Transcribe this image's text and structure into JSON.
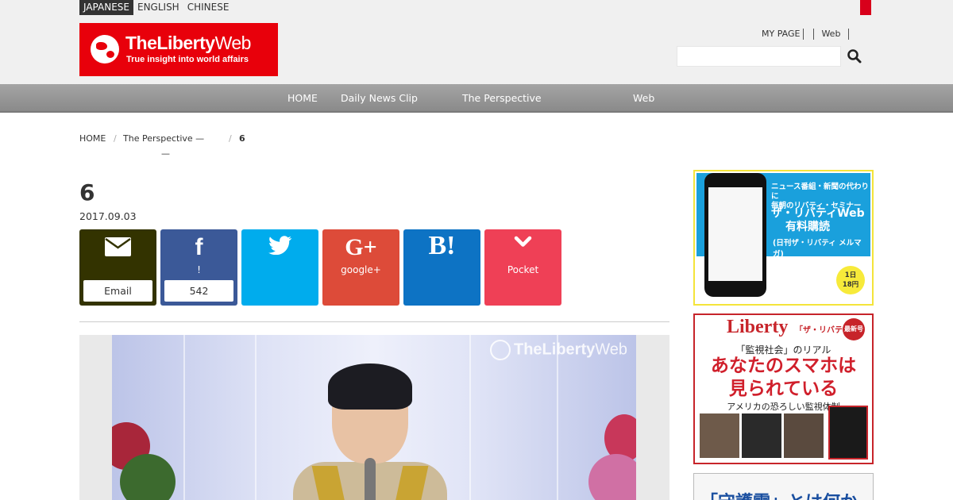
{
  "header": {
    "languages": [
      "JAPANESE",
      "ENGLISH",
      "CHINESE"
    ],
    "active_language": "JAPANESE",
    "logo_name": "TheLiberty",
    "logo_name_suffix": "Web",
    "logo_tagline": "True insight into world affairs",
    "links": [
      "MY PAGE",
      "Web"
    ],
    "search_placeholder": ""
  },
  "nav": {
    "items": [
      "HOME",
      "Daily News Clip",
      "The Perspective",
      "Web"
    ]
  },
  "breadcrumb": {
    "home": "HOME",
    "section": "The Perspective —",
    "section_line2": "—",
    "current": "6"
  },
  "article": {
    "title": "6",
    "date": "2017.09.03"
  },
  "share": {
    "email_label": "Email",
    "facebook_label": "!",
    "facebook_count": "542",
    "googleplus_label": "google+",
    "hatena_icon_text": "B!",
    "pocket_label": "Pocket"
  },
  "photo": {
    "watermark_name": "TheLiberty",
    "watermark_suffix": "Web"
  },
  "sidebar": {
    "ad1": {
      "line1": "ニュース番組・新聞の代わりに",
      "line1b": "毎朝のリバティ・セミナー",
      "line2": "ザ・リバティWeb",
      "line2b": "有料購読",
      "line3": "(日刊ザ・リバティ メルマガ)",
      "badge1": "1日",
      "badge2": "18円"
    },
    "ad2": {
      "brand": "Liberty",
      "brand_sub": "「ザ・リバティ」",
      "new_badge": "最新号",
      "subtitle": "「監視社会」のリアル",
      "headline1": "あなたのスマホは",
      "headline2": "見られている",
      "tagline": "アメリカの恐ろしい監視体制"
    },
    "ad3": {
      "text": "「守護霊」とは何か"
    }
  },
  "colors": {
    "logo_red": "#e8000b",
    "email": "#333300",
    "facebook": "#3b5998",
    "twitter": "#00aced",
    "googleplus": "#dd4b39",
    "hatena": "#0d73c4",
    "pocket": "#ef4056"
  }
}
